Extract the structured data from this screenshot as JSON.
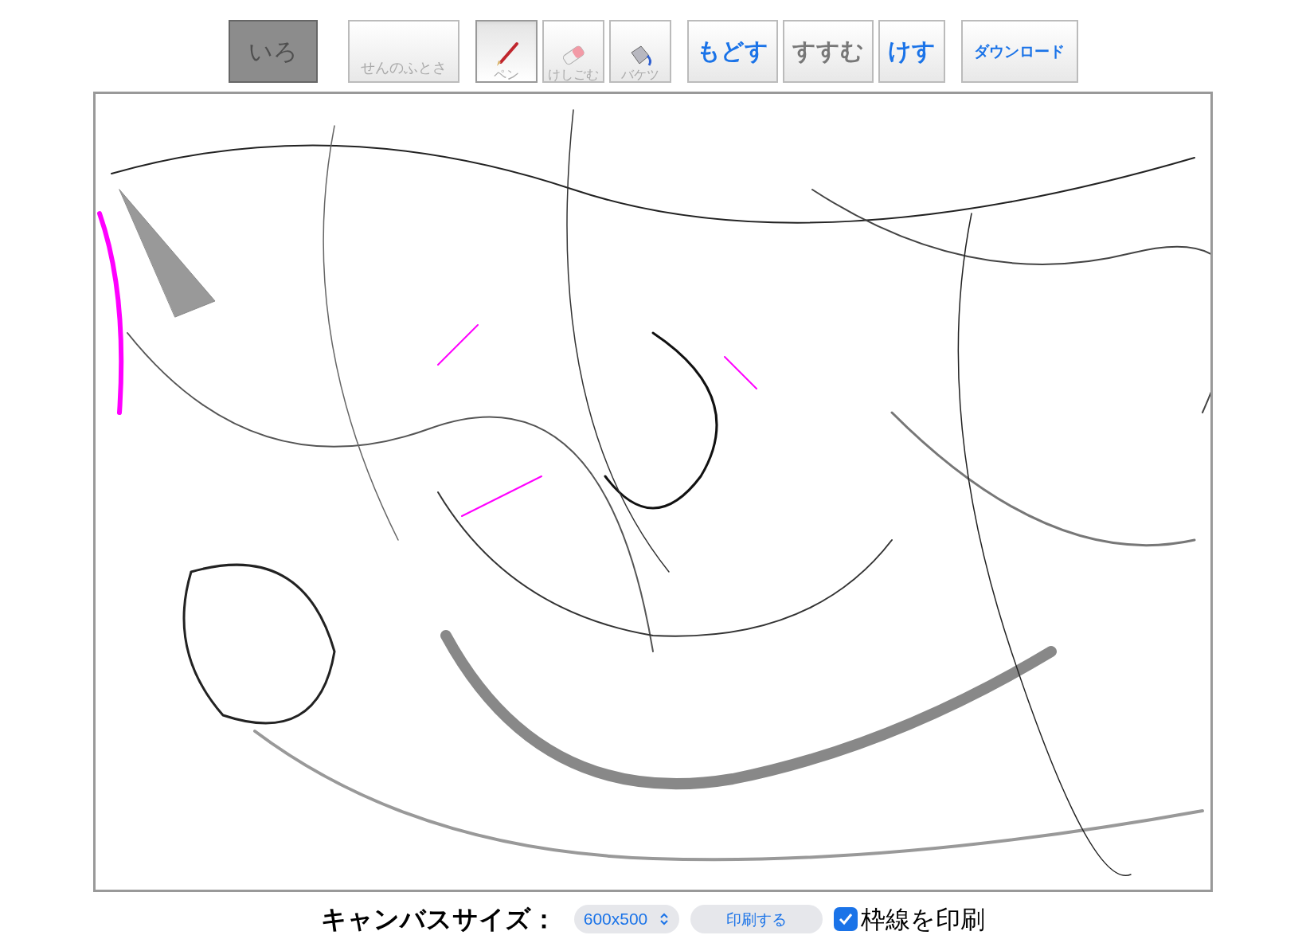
{
  "color_button": {
    "label": "いろ"
  },
  "line_width_button": {
    "label": "せんのふとさ"
  },
  "tools": [
    {
      "kind": "pen",
      "label": "ペン",
      "selected": true
    },
    {
      "kind": "eraser",
      "label": "けしごむ",
      "selected": false
    },
    {
      "kind": "bucket",
      "label": "バケツ",
      "selected": false
    }
  ],
  "actions": [
    {
      "label": "もどす",
      "disabled": false,
      "kind": "large"
    },
    {
      "label": "すすむ",
      "disabled": true,
      "kind": "large"
    },
    {
      "label": "けす",
      "disabled": false,
      "kind": "large"
    },
    {
      "label": "ダウンロード",
      "disabled": false,
      "kind": "small"
    }
  ],
  "footer": {
    "canvas_size_label": "キャンバスサイズ：",
    "canvas_size_value": "600x500",
    "print_button": "印刷する",
    "print_border": {
      "label": "枠線を印刷",
      "checked": true
    }
  }
}
